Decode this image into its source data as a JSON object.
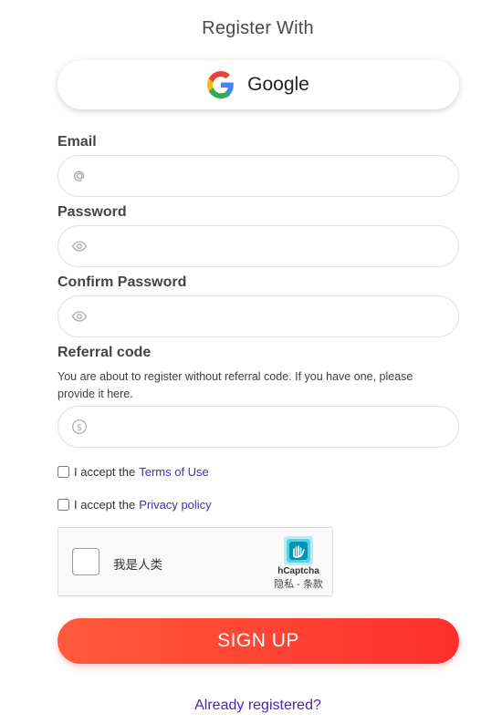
{
  "title": "Register With",
  "google": {
    "label": "Google"
  },
  "fields": {
    "email": {
      "label": "Email",
      "value": "",
      "placeholder": ""
    },
    "password": {
      "label": "Password",
      "value": "",
      "placeholder": ""
    },
    "confirm_password": {
      "label": "Confirm Password",
      "value": "",
      "placeholder": ""
    },
    "referral": {
      "label": "Referral code",
      "note": "You are about to register without referral code. If you have one, please provide it here.",
      "value": "",
      "placeholder": ""
    }
  },
  "terms": {
    "prefix": "I accept the",
    "link": "Terms of Use"
  },
  "privacy": {
    "prefix": "I accept the",
    "link": "Privacy policy"
  },
  "captcha": {
    "label": "我是人类",
    "brand": "hCaptcha",
    "links": "隐私 - 条款"
  },
  "signup_label": "SIGN UP",
  "already_label": "Already registered?",
  "colors": {
    "accent": "#ff3d2e",
    "link": "#4b24b5",
    "google_blue": "#4285F4",
    "google_red": "#EA4335",
    "google_yellow": "#FBBC05",
    "google_green": "#34A853",
    "hcaptcha": "#00bfd8"
  },
  "icons": {
    "email": "at-icon",
    "password": "eye-icon",
    "confirm": "eye-icon",
    "referral": "dollar-icon",
    "google": "google-logo-icon",
    "captcha": "hcaptcha-hand-icon"
  }
}
